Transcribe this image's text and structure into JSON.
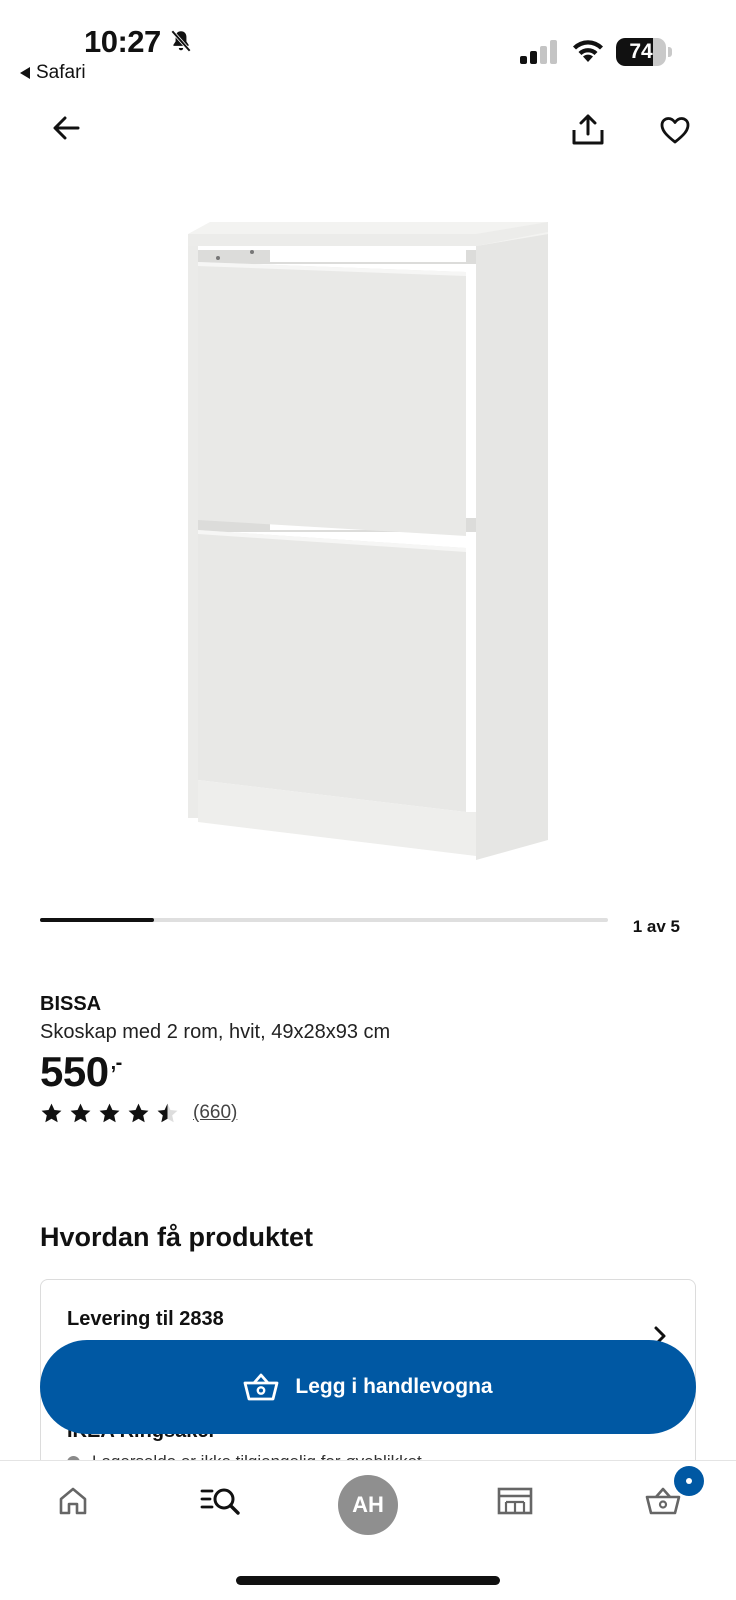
{
  "status_bar": {
    "time": "10:27",
    "back_app": "Safari",
    "battery_level": "74",
    "battery_fraction": 0.74
  },
  "top_nav": {
    "back_icon": "arrow-left-icon",
    "share_icon": "share-icon",
    "favorite_icon": "heart-icon"
  },
  "gallery": {
    "counter": "1 av 5",
    "progress": 0.2
  },
  "product": {
    "brand": "BISSA",
    "description": "Skoskap med 2 rom, hvit, 49x28x93 cm",
    "price": "550",
    "price_suffix": ",-",
    "rating": 4.5,
    "rating_max": 5,
    "review_count": "(660)"
  },
  "availability": {
    "section_title": "Hvordan få produktet",
    "delivery_label": "Levering til 2838",
    "store_label": "IKEA Ringsaker",
    "stock_text": "Lagersaldo er ikke tilgjengelig for øyeblikket"
  },
  "cta": {
    "add_to_cart_label": "Legg i handlevogna",
    "icon": "basket-icon"
  },
  "tab_bar": {
    "home_icon": "home-icon",
    "search_icon": "search-icon",
    "avatar_initials": "AH",
    "store_icon": "store-icon",
    "cart_icon": "basket-icon"
  },
  "colors": {
    "brand_blue": "#0058a3",
    "text": "#111111",
    "avatar_gray": "#8f8f8f"
  }
}
